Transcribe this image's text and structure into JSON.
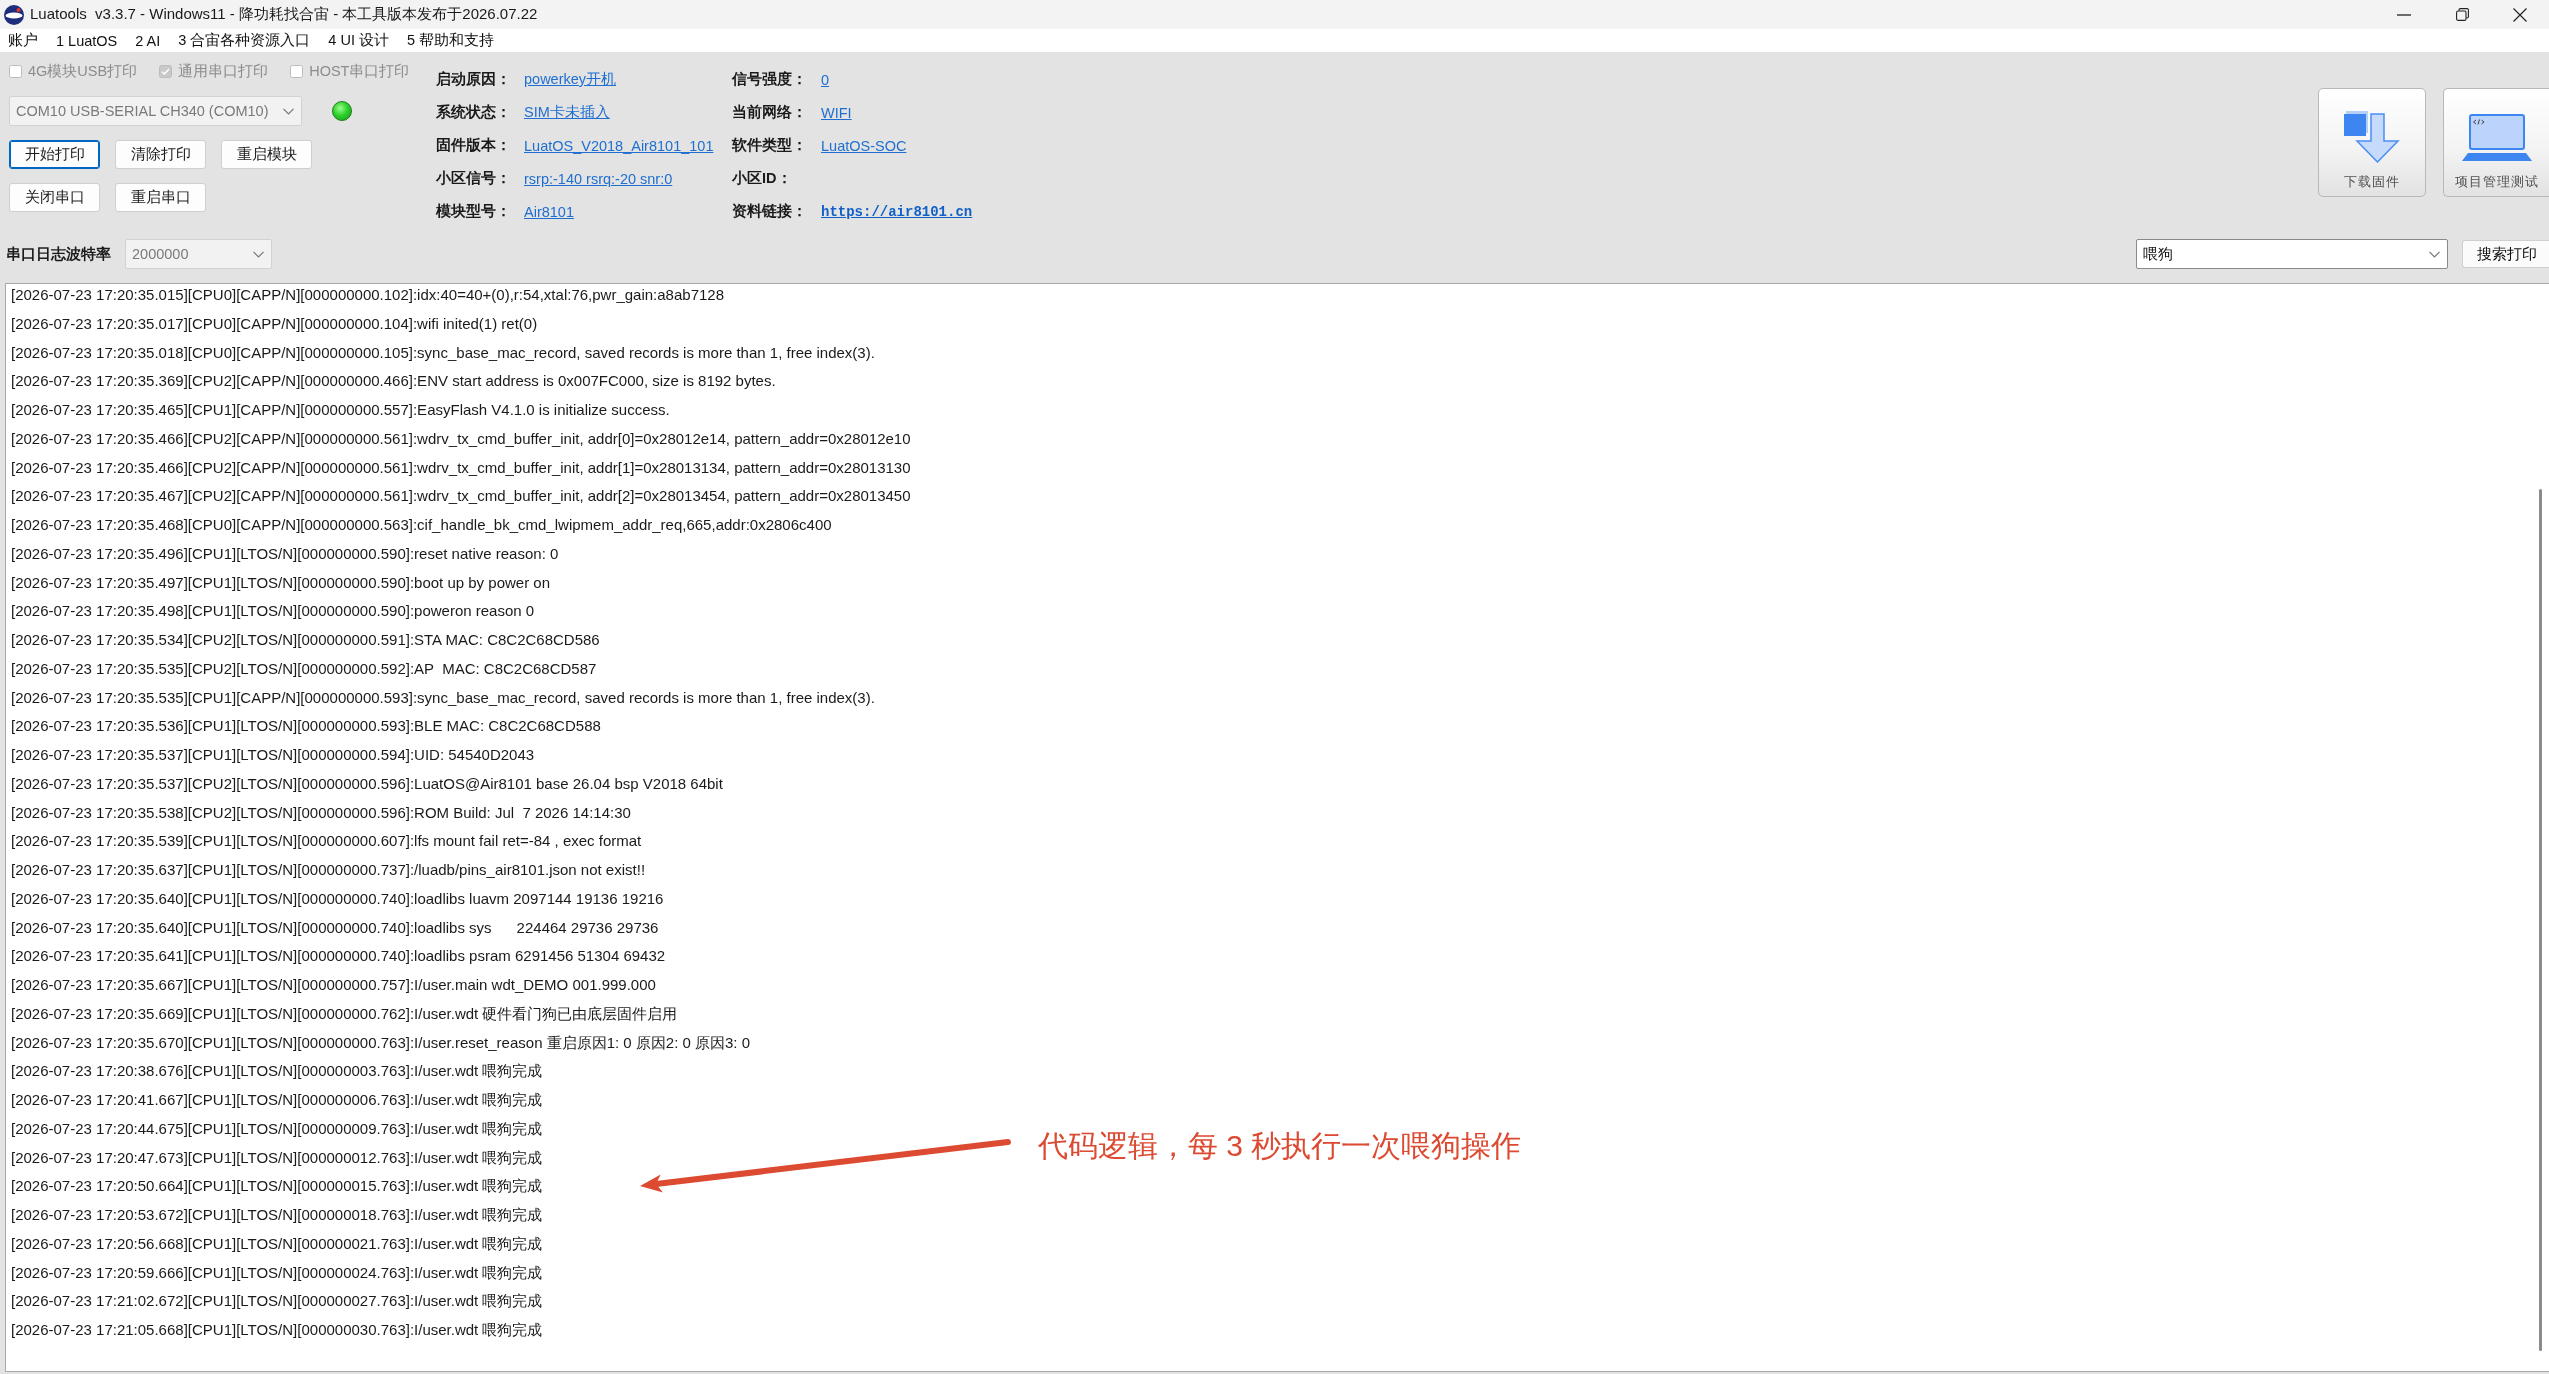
{
  "window": {
    "title": "Luatools  v3.3.7 - Windows11 - 降功耗找合宙 - 本工具版本发布于2026.07.22"
  },
  "menu": [
    {
      "label": "账户"
    },
    {
      "label": "1 LuatOS"
    },
    {
      "label": "2 AI"
    },
    {
      "label": "3 合宙各种资源入口"
    },
    {
      "label": "4 UI 设计"
    },
    {
      "label": "5 帮助和支持"
    }
  ],
  "print_options": [
    {
      "label": "4G模块USB打印",
      "checked": false,
      "disabled": true
    },
    {
      "label": "通用串口打印",
      "checked": true,
      "disabled": true
    },
    {
      "label": "HOST串口打印",
      "checked": false,
      "disabled": true
    }
  ],
  "port_select": {
    "value": "COM10 USB-SERIAL CH340 (COM10)",
    "disabled": true
  },
  "connection": {
    "connected": true
  },
  "button_rows": [
    [
      {
        "label": "开始打印",
        "focused": true
      },
      {
        "label": "清除打印",
        "focused": false
      },
      {
        "label": "重启模块",
        "focused": false
      }
    ],
    [
      {
        "label": "关闭串口",
        "focused": false
      },
      {
        "label": "重启串口",
        "focused": false
      }
    ]
  ],
  "device_info": [
    {
      "label": "启动原因：",
      "value": "powerkey开机",
      "kind": "link"
    },
    {
      "label": "信号强度：",
      "value": "0",
      "kind": "link"
    },
    {
      "label": "系统状态：",
      "value": "SIM卡未插入",
      "kind": "link"
    },
    {
      "label": "当前网络：",
      "value": "WIFI",
      "kind": "link"
    },
    {
      "label": "固件版本：",
      "value": "LuatOS_V2018_Air8101_101",
      "kind": "link"
    },
    {
      "label": "软件类型：",
      "value": "LuatOS-SOC",
      "kind": "link"
    },
    {
      "label": "小区信号：",
      "value": "rsrp:-140 rsrq:-20 snr:0",
      "kind": "link"
    },
    {
      "label": "小区ID："
    },
    {
      "label": "模块型号：",
      "value": "Air8101",
      "kind": "link"
    },
    {
      "label": "资料链接：",
      "value": "https://air8101.cn",
      "kind": "url"
    }
  ],
  "tools": [
    {
      "kind": "download",
      "label": "下载固件"
    },
    {
      "kind": "project",
      "label": "项目管理测试"
    }
  ],
  "baud_rate": {
    "label": "串口日志波特率",
    "value": "2000000",
    "disabled": true
  },
  "search": {
    "value": "喂狗",
    "button": "搜索打印"
  },
  "log": {
    "lines": [
      "[2026-07-23 17:20:35.015][CPU0][CAPP/N][000000000.102]:idx:40=40+(0),r:54,xtal:76,pwr_gain:a8ab7128",
      "[2026-07-23 17:20:35.017][CPU0][CAPP/N][000000000.104]:wifi inited(1) ret(0)",
      "[2026-07-23 17:20:35.018][CPU0][CAPP/N][000000000.105]:sync_base_mac_record, saved records is more than 1, free index(3).",
      "[2026-07-23 17:20:35.369][CPU2][CAPP/N][000000000.466]:ENV start address is 0x007FC000, size is 8192 bytes.",
      "[2026-07-23 17:20:35.465][CPU1][CAPP/N][000000000.557]:EasyFlash V4.1.0 is initialize success.",
      "[2026-07-23 17:20:35.466][CPU2][CAPP/N][000000000.561]:wdrv_tx_cmd_buffer_init, addr[0]=0x28012e14, pattern_addr=0x28012e10",
      "[2026-07-23 17:20:35.466][CPU2][CAPP/N][000000000.561]:wdrv_tx_cmd_buffer_init, addr[1]=0x28013134, pattern_addr=0x28013130",
      "[2026-07-23 17:20:35.467][CPU2][CAPP/N][000000000.561]:wdrv_tx_cmd_buffer_init, addr[2]=0x28013454, pattern_addr=0x28013450",
      "[2026-07-23 17:20:35.468][CPU0][CAPP/N][000000000.563]:cif_handle_bk_cmd_lwipmem_addr_req,665,addr:0x2806c400",
      "[2026-07-23 17:20:35.496][CPU1][LTOS/N][000000000.590]:reset native reason: 0",
      "[2026-07-23 17:20:35.497][CPU1][LTOS/N][000000000.590]:boot up by power on",
      "[2026-07-23 17:20:35.498][CPU1][LTOS/N][000000000.590]:poweron reason 0",
      "[2026-07-23 17:20:35.534][CPU2][LTOS/N][000000000.591]:STA MAC: C8C2C68CD586",
      "[2026-07-23 17:20:35.535][CPU2][LTOS/N][000000000.592]:AP  MAC: C8C2C68CD587",
      "[2026-07-23 17:20:35.535][CPU1][CAPP/N][000000000.593]:sync_base_mac_record, saved records is more than 1, free index(3).",
      "[2026-07-23 17:20:35.536][CPU1][LTOS/N][000000000.593]:BLE MAC: C8C2C68CD588",
      "[2026-07-23 17:20:35.537][CPU1][LTOS/N][000000000.594]:UID: 54540D2043",
      "[2026-07-23 17:20:35.537][CPU2][LTOS/N][000000000.596]:LuatOS@Air8101 base 26.04 bsp V2018 64bit",
      "[2026-07-23 17:20:35.538][CPU2][LTOS/N][000000000.596]:ROM Build: Jul  7 2026 14:14:30",
      "[2026-07-23 17:20:35.539][CPU1][LTOS/N][000000000.607]:lfs mount fail ret=-84 , exec format",
      "[2026-07-23 17:20:35.637][CPU1][LTOS/N][000000000.737]:/luadb/pins_air8101.json not exist!!",
      "[2026-07-23 17:20:35.640][CPU1][LTOS/N][000000000.740]:loadlibs luavm 2097144 19136 19216",
      "[2026-07-23 17:20:35.640][CPU1][LTOS/N][000000000.740]:loadlibs sys      224464 29736 29736",
      "[2026-07-23 17:20:35.641][CPU1][LTOS/N][000000000.740]:loadlibs psram 6291456 51304 69432",
      "[2026-07-23 17:20:35.667][CPU1][LTOS/N][000000000.757]:I/user.main wdt_DEMO 001.999.000",
      "[2026-07-23 17:20:35.669][CPU1][LTOS/N][000000000.762]:I/user.wdt 硬件看门狗已由底层固件启用",
      "[2026-07-23 17:20:35.670][CPU1][LTOS/N][000000000.763]:I/user.reset_reason 重启原因1: 0 原因2: 0 原因3: 0",
      "[2026-07-23 17:20:38.676][CPU1][LTOS/N][000000003.763]:I/user.wdt 喂狗完成",
      "[2026-07-23 17:20:41.667][CPU1][LTOS/N][000000006.763]:I/user.wdt 喂狗完成",
      "[2026-07-23 17:20:44.675][CPU1][LTOS/N][000000009.763]:I/user.wdt 喂狗完成",
      "[2026-07-23 17:20:47.673][CPU1][LTOS/N][000000012.763]:I/user.wdt 喂狗完成",
      "[2026-07-23 17:20:50.664][CPU1][LTOS/N][000000015.763]:I/user.wdt 喂狗完成",
      "[2026-07-23 17:20:53.672][CPU1][LTOS/N][000000018.763]:I/user.wdt 喂狗完成",
      "[2026-07-23 17:20:56.668][CPU1][LTOS/N][000000021.763]:I/user.wdt 喂狗完成",
      "[2026-07-23 17:20:59.666][CPU1][LTOS/N][000000024.763]:I/user.wdt 喂狗完成",
      "[2026-07-23 17:21:02.672][CPU1][LTOS/N][000000027.763]:I/user.wdt 喂狗完成",
      "[2026-07-23 17:21:05.668][CPU1][LTOS/N][000000030.763]:I/user.wdt 喂狗完成"
    ]
  },
  "annotation": {
    "text": "代码逻辑，每 3 秒执行一次喂狗操作"
  }
}
